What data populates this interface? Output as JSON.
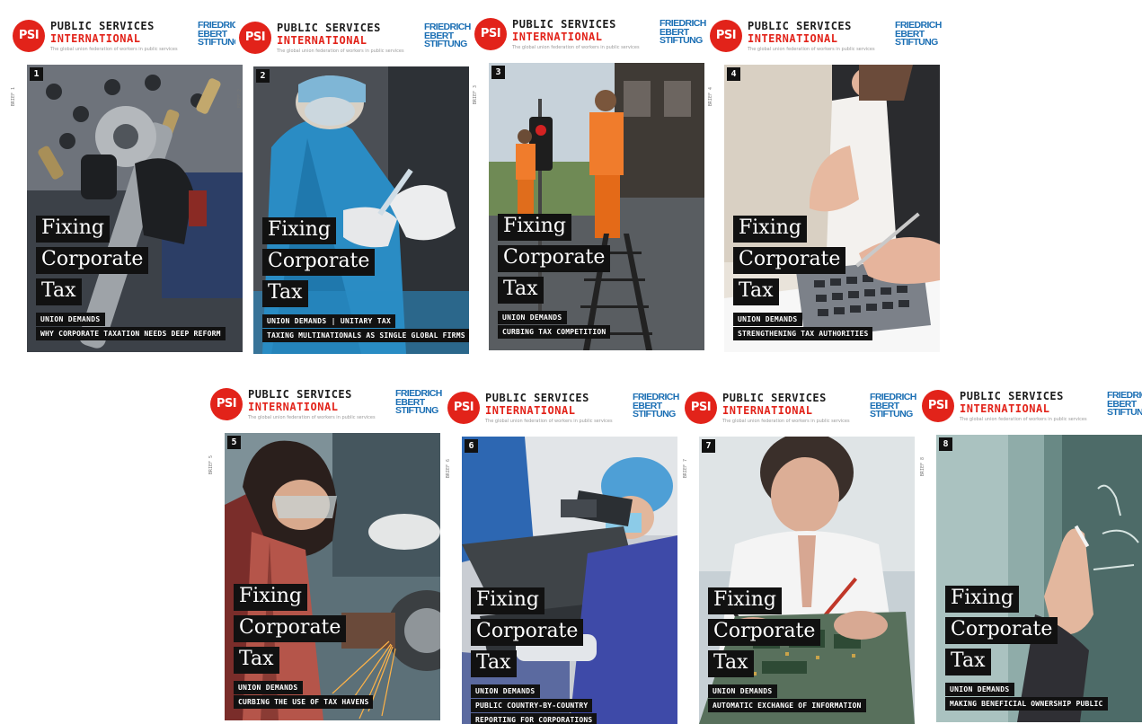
{
  "publisher": {
    "name_line1": "PUBLIC SERVICES",
    "name_line2": "INTERNATIONAL",
    "tagline": "The global union federation of workers in public services",
    "logo_text": "PSI",
    "partner_line1": "FRIEDRICH",
    "partner_line2": "EBERT",
    "partner_line3": "STIFTUNG"
  },
  "title": {
    "line1": "Fixing",
    "line2": "Corporate",
    "line3": "Tax"
  },
  "covers": [
    {
      "number": "1",
      "side": "BRIEF 1",
      "tag1": "UNION DEMANDS",
      "tag2": "WHY CORPORATE TAXATION NEEDS DEEP REFORM",
      "tag3": "",
      "scene": "wrench"
    },
    {
      "number": "2",
      "side": "BRIEF 2",
      "tag1": "UNION DEMANDS | UNITARY TAX",
      "tag2": "TAXING MULTINATIONALS AS SINGLE GLOBAL FIRMS",
      "tag3": "",
      "scene": "lab"
    },
    {
      "number": "3",
      "side": "BRIEF 3",
      "tag1": "UNION DEMANDS",
      "tag2": "CURBING TAX COMPETITION",
      "tag3": "",
      "scene": "street"
    },
    {
      "number": "4",
      "side": "BRIEF 4",
      "tag1": "UNION DEMANDS",
      "tag2": "STRENGTHENING TAX AUTHORITIES",
      "tag3": "",
      "scene": "office"
    },
    {
      "number": "5",
      "side": "BRIEF 5",
      "tag1": "UNION DEMANDS",
      "tag2": "CURBING THE USE OF TAX HAVENS",
      "tag3": "",
      "scene": "grinder"
    },
    {
      "number": "6",
      "side": "BRIEF 6",
      "tag1": "UNION DEMANDS",
      "tag2": "PUBLIC COUNTRY-BY-COUNTRY",
      "tag3": "REPORTING FOR CORPORATIONS",
      "scene": "surgery"
    },
    {
      "number": "7",
      "side": "BRIEF 7",
      "tag1": "UNION DEMANDS",
      "tag2": "AUTOMATIC EXCHANGE OF INFORMATION",
      "tag3": "",
      "scene": "electronics"
    },
    {
      "number": "8",
      "side": "BRIEF 8",
      "tag1": "UNION DEMANDS",
      "tag2": "MAKING BENEFICIAL OWNERSHIP PUBLIC",
      "tag3": "",
      "scene": "board"
    }
  ]
}
